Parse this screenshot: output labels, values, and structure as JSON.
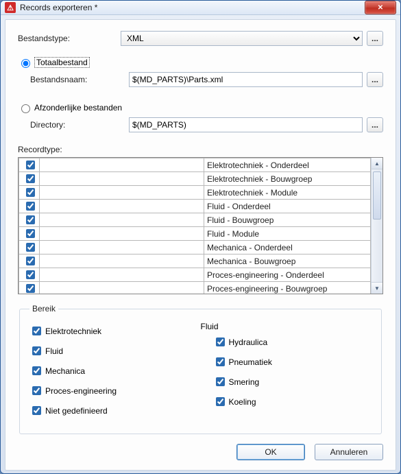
{
  "window": {
    "title": "Records exporteren *",
    "icon_glyph": "⚠"
  },
  "labels": {
    "file_type": "Bestandstype:",
    "total_file": "Totaalbestand",
    "file_name": "Bestandsnaam:",
    "separate_files": "Afzonderlijke bestanden",
    "directory": "Directory:",
    "record_type": "Recordtype:",
    "range": "Bereik",
    "fluid": "Fluid",
    "browse": "..."
  },
  "file_type": {
    "selected": "XML",
    "options": [
      "XML"
    ]
  },
  "mode": {
    "total_selected": true,
    "separate_selected": false
  },
  "file_name_value": "$(MD_PARTS)\\Parts.xml",
  "directory_value": "$(MD_PARTS)",
  "record_types": [
    {
      "checked": true,
      "label": "Elektrotechniek - Onderdeel"
    },
    {
      "checked": true,
      "label": "Elektrotechniek - Bouwgroep"
    },
    {
      "checked": true,
      "label": "Elektrotechniek - Module"
    },
    {
      "checked": true,
      "label": "Fluid - Onderdeel"
    },
    {
      "checked": true,
      "label": "Fluid - Bouwgroep"
    },
    {
      "checked": true,
      "label": "Fluid - Module"
    },
    {
      "checked": true,
      "label": "Mechanica - Onderdeel"
    },
    {
      "checked": true,
      "label": "Mechanica - Bouwgroep"
    },
    {
      "checked": true,
      "label": "Proces-engineering - Onderdeel"
    },
    {
      "checked": true,
      "label": "Proces-engineering - Bouwgroep"
    }
  ],
  "range": {
    "left": [
      {
        "checked": true,
        "label": "Elektrotechniek"
      },
      {
        "checked": true,
        "label": "Fluid"
      },
      {
        "checked": true,
        "label": "Mechanica"
      },
      {
        "checked": true,
        "label": "Proces-engineering"
      },
      {
        "checked": true,
        "label": "Niet gedefinieerd"
      }
    ],
    "right": [
      {
        "checked": true,
        "label": "Hydraulica"
      },
      {
        "checked": true,
        "label": "Pneumatiek"
      },
      {
        "checked": true,
        "label": "Smering"
      },
      {
        "checked": true,
        "label": "Koeling"
      }
    ]
  },
  "buttons": {
    "ok": "OK",
    "cancel": "Annuleren"
  }
}
